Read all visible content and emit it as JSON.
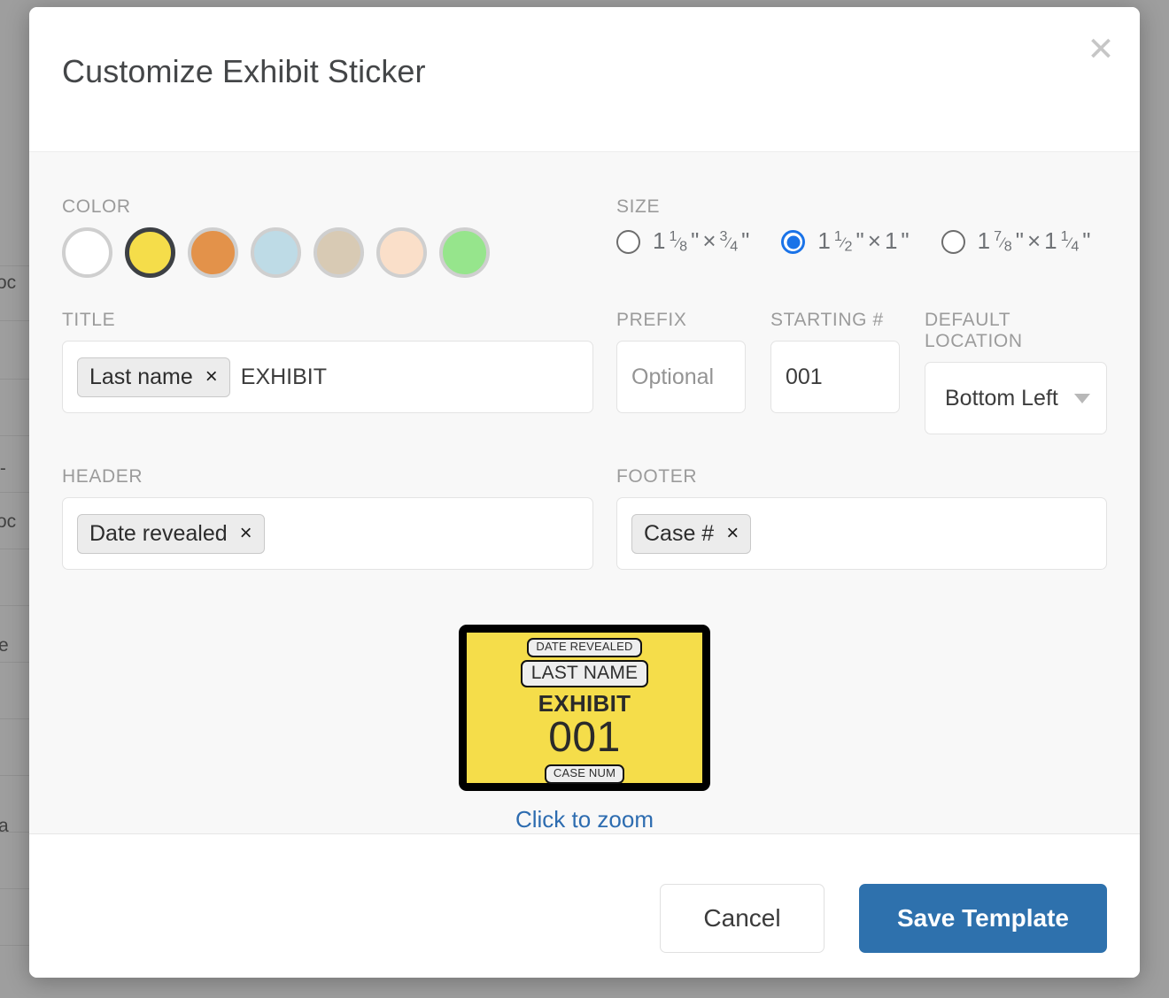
{
  "modal": {
    "title": "Customize Exhibit Sticker",
    "close_icon": "close-icon"
  },
  "color": {
    "label": "COLOR",
    "selected_index": 1,
    "swatches": [
      {
        "name": "white",
        "hex": "#ffffff"
      },
      {
        "name": "yellow",
        "hex": "#f5dd4a"
      },
      {
        "name": "orange",
        "hex": "#e3924a"
      },
      {
        "name": "light-blue",
        "hex": "#bedbe6"
      },
      {
        "name": "tan",
        "hex": "#d8cab4"
      },
      {
        "name": "peach",
        "hex": "#fadfc9"
      },
      {
        "name": "green",
        "hex": "#96e58c"
      }
    ]
  },
  "size": {
    "label": "SIZE",
    "selected_index": 1,
    "options": [
      {
        "whole": "1",
        "num1": "1",
        "den1": "8",
        "x": "×",
        "whole2": "",
        "num2": "3",
        "den2": "4",
        "text": "1 1/8\" × 3/4\""
      },
      {
        "whole": "1",
        "num1": "1",
        "den1": "2",
        "x": "×",
        "whole2": "1",
        "num2": "",
        "den2": "",
        "text": "1 1/2\" × 1\""
      },
      {
        "whole": "1",
        "num1": "7",
        "den1": "8",
        "x": "×",
        "whole2": "1",
        "num2": "1",
        "den2": "4",
        "text": "1 7/8\" × 1 1/4\""
      }
    ]
  },
  "title_field": {
    "label": "TITLE",
    "chip": "Last name",
    "chip_remove": "×",
    "value": "EXHIBIT"
  },
  "prefix": {
    "label": "PREFIX",
    "value": "",
    "placeholder": "Optional"
  },
  "starting_number": {
    "label": "STARTING #",
    "value": "001"
  },
  "default_location": {
    "label": "DEFAULT LOCATION",
    "value": "Bottom Left",
    "caret_icon": "chevron-down-icon"
  },
  "header_field": {
    "label": "HEADER",
    "chip": "Date revealed",
    "chip_remove": "×"
  },
  "footer_field": {
    "label": "FOOTER",
    "chip": "Case #",
    "chip_remove": "×"
  },
  "preview": {
    "date_revealed": "DATE REVEALED",
    "last_name": "LAST NAME",
    "title": "EXHIBIT",
    "number": "001",
    "case_num": "CASE NUM",
    "zoom_link": "Click to zoom",
    "background_hex": "#f5dd4a",
    "border_hex": "#000000"
  },
  "footer": {
    "cancel": "Cancel",
    "save": "Save Template",
    "save_hex": "#2e71ad"
  },
  "backdrop": {
    "fragments": [
      "oc",
      "t-",
      "oc",
      "e",
      "a"
    ]
  }
}
